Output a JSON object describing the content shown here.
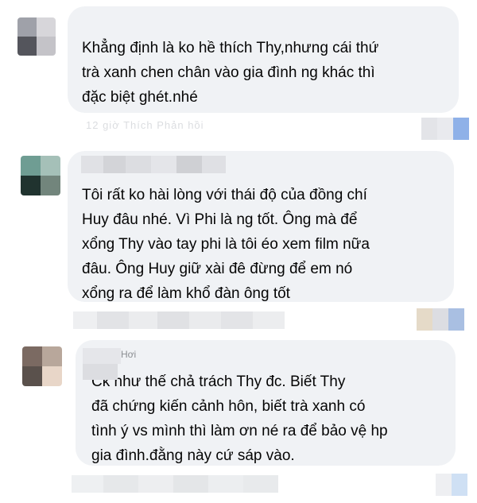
{
  "comments": [
    {
      "author_label": "",
      "text": "Khẳng định là ko hề thích Thy,nhưng cái thứ\ntrà xanh chen chân vào gia đình ng khác thì\nđặc biệt ghét.nhé",
      "meta_fragment": "12 giờ  Thích  Phản hồi"
    },
    {
      "author_label": "",
      "text": "Tôi rất ko hài lòng với thái độ của đồng chí\nHuy đâu nhé. Vì Phi là ng tốt. Ông mà để\nxổng Thy vào tay phi là tôi éo xem film nữa\nđâu. Ông Huy giữ xài đê đừng để em nó\nxổng ra để làm khổ đàn ông tốt",
      "meta_fragment": ""
    },
    {
      "author_label": "Hơi",
      "text": "Ck như thế chả trách Thy đc. Biết Thy\nđã chứng kiến cảnh hôn, biết trà xanh có\ntình ý vs mình thì làm ơn né ra để bảo vệ hp\ngia đình.đằng này cứ sáp vào.",
      "meta_fragment": ""
    }
  ],
  "colors": {
    "bubble": "#f0f2f5",
    "text": "#050505"
  }
}
